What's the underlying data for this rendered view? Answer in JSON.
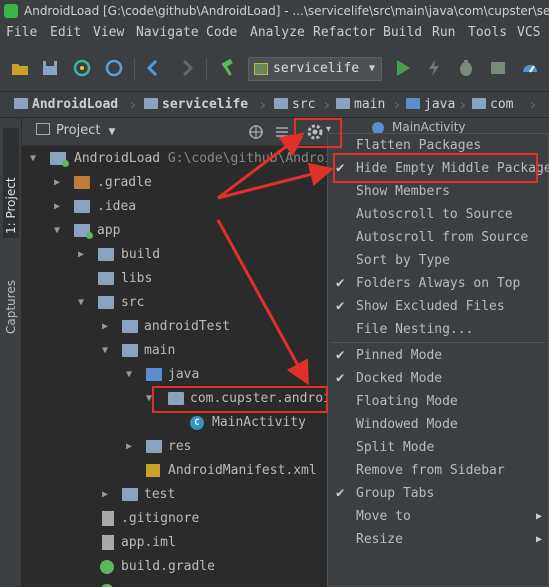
{
  "window": {
    "title": "AndroidLoad [G:\\code\\github\\AndroidLoad] - ...\\servicelife\\src\\main\\java\\com\\cupster\\servicelife\\MainActivity.java"
  },
  "menubar": [
    "File",
    "Edit",
    "View",
    "Navigate",
    "Code",
    "Analyze",
    "Refactor",
    "Build",
    "Run",
    "Tools",
    "VCS"
  ],
  "toolbar": {
    "run_config": "servicelife",
    "icons": [
      "open-folder-icon",
      "save-icon",
      "sync-icon",
      "refresh-icon",
      "back-arrow-icon",
      "forward-arrow-icon",
      "build-hammer-icon",
      "run-icon",
      "apply-changes-icon",
      "debug-icon",
      "profiler-icon"
    ]
  },
  "breadcrumb": [
    "AndroidLoad",
    "servicelife",
    "src",
    "main",
    "java",
    "com"
  ],
  "leftstrip": {
    "project_tab": "1: Project",
    "captures_tab": "Captures"
  },
  "panel": {
    "title": "Project"
  },
  "editor_tab": "MainActivity",
  "tree": [
    {
      "label": "AndroidLoad",
      "hint": "G:\\code\\github\\AndroidLoad",
      "icon": "module",
      "arrow": "down"
    },
    {
      "label": ".gradle",
      "icon": "folder-orange",
      "arrow": "right"
    },
    {
      "label": ".idea",
      "icon": "folder",
      "arrow": "right"
    },
    {
      "label": "app",
      "icon": "module",
      "arrow": "down"
    },
    {
      "label": "build",
      "icon": "folder",
      "arrow": "right"
    },
    {
      "label": "libs",
      "icon": "folder",
      "arrow": "none"
    },
    {
      "label": "src",
      "icon": "folder",
      "arrow": "down"
    },
    {
      "label": "androidTest",
      "icon": "folder",
      "arrow": "right"
    },
    {
      "label": "main",
      "icon": "folder",
      "arrow": "down"
    },
    {
      "label": "java",
      "icon": "folder-blue",
      "arrow": "down"
    },
    {
      "label": "com.cupster.android.",
      "icon": "package",
      "arrow": "down"
    },
    {
      "label": "MainActivity",
      "icon": "class",
      "arrow": "none"
    },
    {
      "label": "res",
      "icon": "folder",
      "arrow": "right"
    },
    {
      "label": "AndroidManifest.xml",
      "icon": "xml",
      "arrow": "none"
    },
    {
      "label": "test",
      "icon": "folder",
      "arrow": "right"
    },
    {
      "label": ".gitignore",
      "icon": "file",
      "arrow": "none"
    },
    {
      "label": "app.iml",
      "icon": "file",
      "arrow": "none"
    },
    {
      "label": "build.gradle",
      "icon": "gradle",
      "arrow": "none"
    }
  ],
  "gear_menu": [
    {
      "label": "Flatten Packages",
      "checked": false
    },
    {
      "label": "Hide Empty Middle Packages",
      "checked": true
    },
    {
      "label": "Show Members",
      "checked": false
    },
    {
      "label": "Autoscroll to Source",
      "checked": false
    },
    {
      "label": "Autoscroll from Source",
      "checked": false
    },
    {
      "label": "Sort by Type",
      "checked": false
    },
    {
      "label": "Folders Always on Top",
      "checked": true
    },
    {
      "label": "Show Excluded Files",
      "checked": true
    },
    {
      "label": "File Nesting...",
      "checked": false
    },
    {
      "label": "Pinned Mode",
      "checked": true
    },
    {
      "label": "Docked Mode",
      "checked": true
    },
    {
      "label": "Floating Mode",
      "checked": false
    },
    {
      "label": "Windowed Mode",
      "checked": false
    },
    {
      "label": "Split Mode",
      "checked": false
    },
    {
      "label": "Remove from Sidebar",
      "checked": false
    },
    {
      "label": "Group Tabs",
      "checked": true
    },
    {
      "label": "Move to",
      "checked": false,
      "submenu": true
    },
    {
      "label": "Resize",
      "checked": false,
      "submenu": true
    }
  ],
  "colors": {
    "background": "#2b2b2b",
    "chrome": "#3c3f41",
    "annotation_red": "#e0302a",
    "run_green": "#499c54"
  }
}
